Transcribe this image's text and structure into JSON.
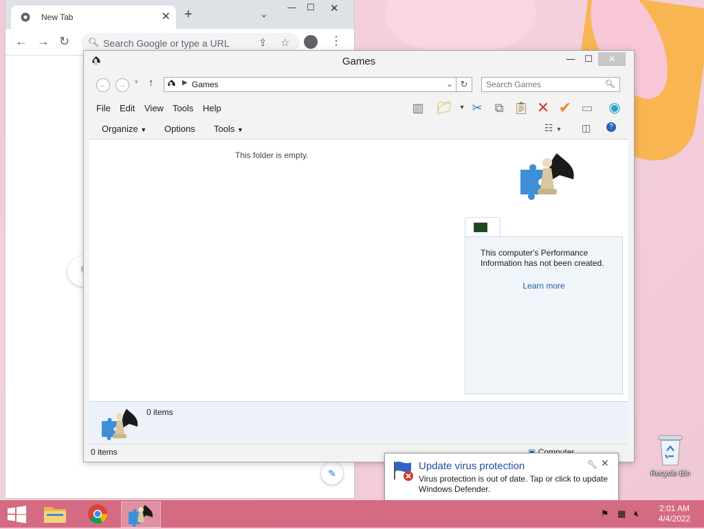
{
  "chrome": {
    "tab_title": "New Tab",
    "omnibox_placeholder": "Search Google or type a URL"
  },
  "explorer": {
    "title": "Games",
    "address": "Games",
    "search_placeholder": "Search Games",
    "menu": [
      "File",
      "Edit",
      "View",
      "Tools",
      "Help"
    ],
    "commands": {
      "organize": "Organize",
      "options": "Options",
      "tools": "Tools"
    },
    "empty_message": "This folder is empty.",
    "perf_message": "This computer's Performance Information has not been created.",
    "learn_more": "Learn more",
    "details_count": "0 items",
    "status_count": "0 items",
    "status_location": "Computer"
  },
  "toast": {
    "title": "Update virus protection",
    "body": "Virus protection is out of date. Tap or click to update Windows Defender."
  },
  "desktop": {
    "recycle_bin": "Recycle Bin"
  },
  "clock": {
    "time": "2:01 AM",
    "date": "4/4/2022"
  },
  "colors": {
    "taskbar": "#d46b82",
    "toast_title": "#1f4ea8",
    "link": "#1f5fa6"
  }
}
